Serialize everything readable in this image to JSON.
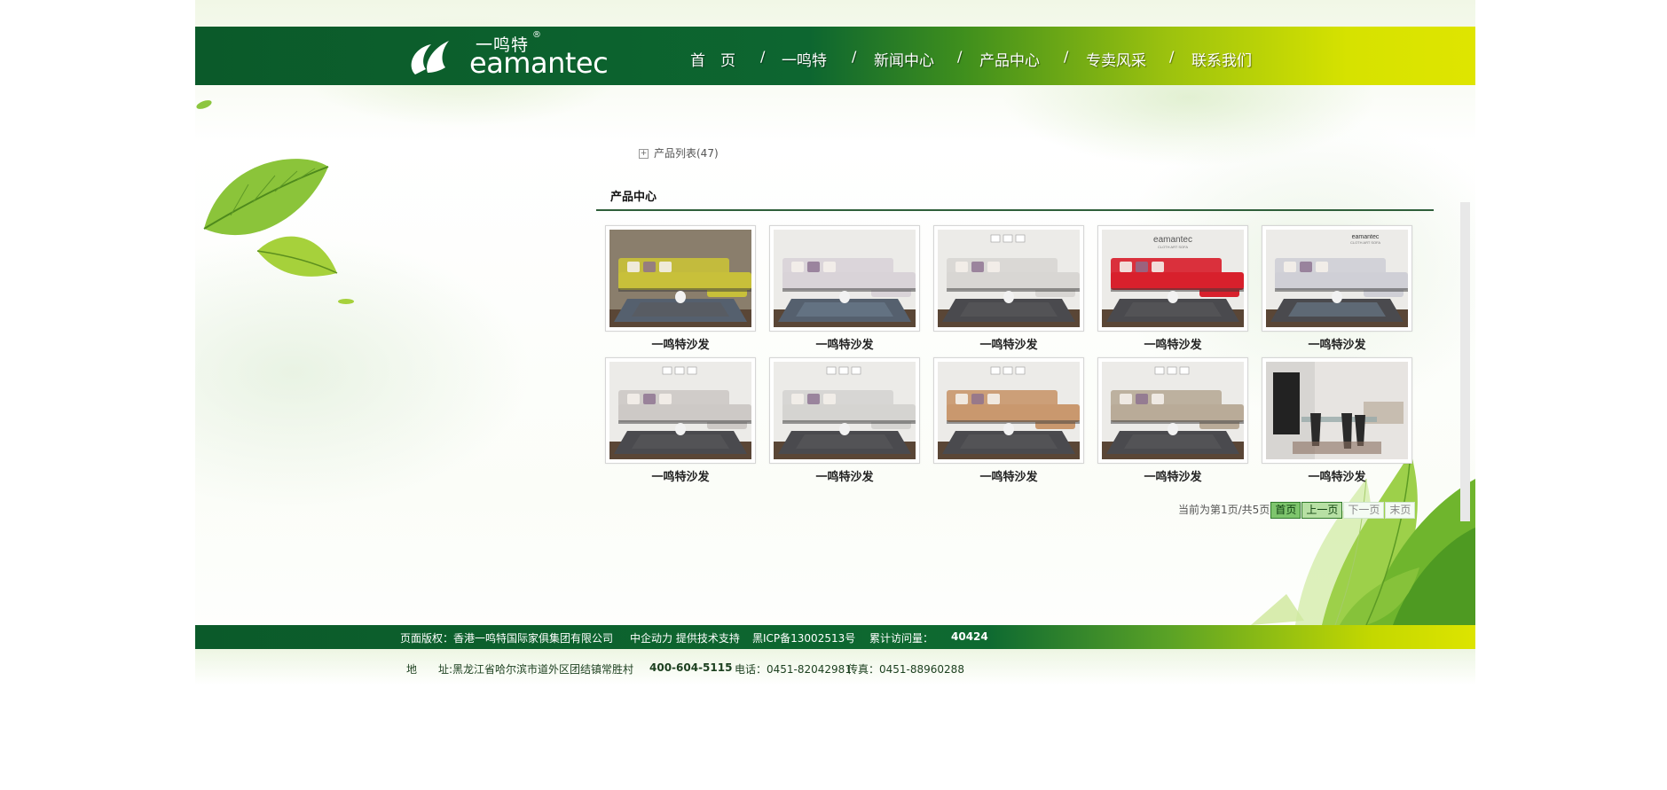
{
  "header": {
    "logo_cn": "一鸣特",
    "logo_reg": "®",
    "logo_en": "eamantec",
    "nav": [
      "首　页",
      "一鸣特",
      "新闻中心",
      "产品中心",
      "专卖风采",
      "联系我们"
    ],
    "nav_separator": "/"
  },
  "sidebar": {
    "category_toggle": "+",
    "category_label": "产品列表(47)"
  },
  "main": {
    "section_title": "产品中心",
    "products": [
      {
        "caption": "一鸣特沙发",
        "sofa_color": "#c8c03a"
      },
      {
        "caption": "一鸣特沙发",
        "sofa_color": "#d9d3d8"
      },
      {
        "caption": "一鸣特沙发",
        "sofa_color": "#d8d6d3"
      },
      {
        "caption": "一鸣特沙发",
        "sofa_color": "#d8202c"
      },
      {
        "caption": "一鸣特沙发",
        "sofa_color": "#cfcfd6"
      },
      {
        "caption": "一鸣特沙发",
        "sofa_color": "#cdc9c6"
      },
      {
        "caption": "一鸣特沙发",
        "sofa_color": "#d5d4d1"
      },
      {
        "caption": "一鸣特沙发",
        "sofa_color": "#c9986e"
      },
      {
        "caption": "一鸣特沙发",
        "sofa_color": "#b9ab98"
      },
      {
        "caption": "一鸣特沙发",
        "sofa_color": "#2a2a2a"
      }
    ],
    "thumb_brand_4": "eamantec",
    "thumb_brand_4_sub": "CLOTH ART SOFA",
    "thumb_brand_5": "eamantec",
    "thumb_brand_5_sub": "CLOTH ART SOFA"
  },
  "pager": {
    "status": "当前为第1页/共5页",
    "first": "首页",
    "prev": "上一页",
    "next": "下一页",
    "last": "末页"
  },
  "footer": {
    "copyright": "页面版权：香港一鸣特国际家俱集团有限公司",
    "support": "中企动力 提供技术支持",
    "icp": "黑ICP备13002513号",
    "visits_label": "累计访问量：",
    "visits_value": "40424",
    "address": "地　　址:黑龙江省哈尔滨市道外区团结镇常胜村",
    "hotline": "400-604-5115",
    "phone": "电话：0451-82042981",
    "fax": "传真：0451-88960288"
  },
  "colors": {
    "header_dark": "#0b5a2a",
    "header_light": "#dfe500",
    "pager_active": "#7ec56d"
  }
}
